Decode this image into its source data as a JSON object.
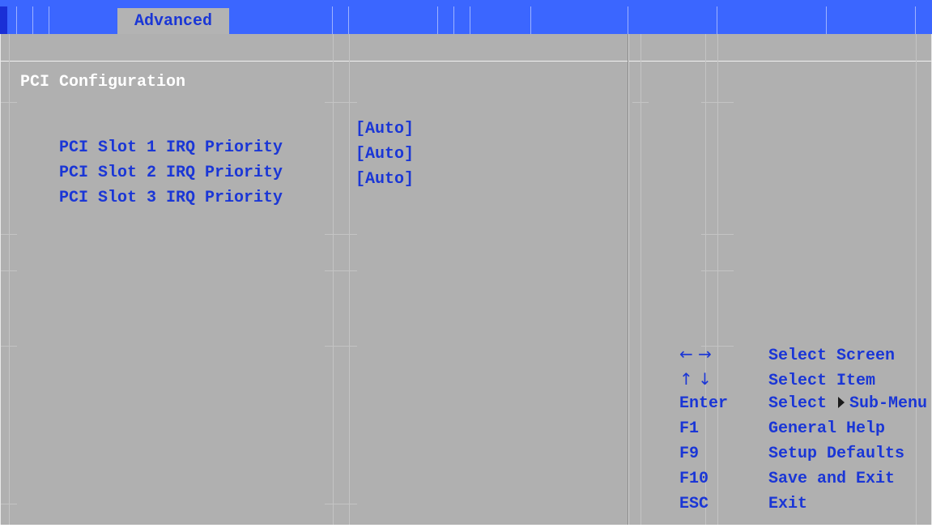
{
  "tabs": [
    {
      "label": "Advanced",
      "active": true
    }
  ],
  "section": {
    "title": "PCI Configuration"
  },
  "settings": [
    {
      "label": "PCI Slot 1 IRQ Priority",
      "value": "[Auto]"
    },
    {
      "label": "PCI Slot 2 IRQ Priority",
      "value": "[Auto]"
    },
    {
      "label": "PCI Slot 3 IRQ Priority",
      "value": "[Auto]"
    }
  ],
  "help": [
    {
      "key": "← →",
      "desc": "Select Screen"
    },
    {
      "key": "↑ ↓",
      "desc": "Select Item"
    },
    {
      "key": "Enter",
      "desc_before": "Select",
      "desc_after": "Sub-Menu",
      "icon": "triangle-right-icon"
    },
    {
      "key": "F1",
      "desc": "General Help"
    },
    {
      "key": "F9",
      "desc": "Setup Defaults"
    },
    {
      "key": "F10",
      "desc": "Save and Exit"
    },
    {
      "key": "ESC",
      "desc": "Exit"
    }
  ],
  "colors": {
    "tab_bar": "#3b66ff",
    "panel": "#b0b0b0",
    "text_blue": "#1a36d6",
    "title_white": "#ffffff"
  }
}
